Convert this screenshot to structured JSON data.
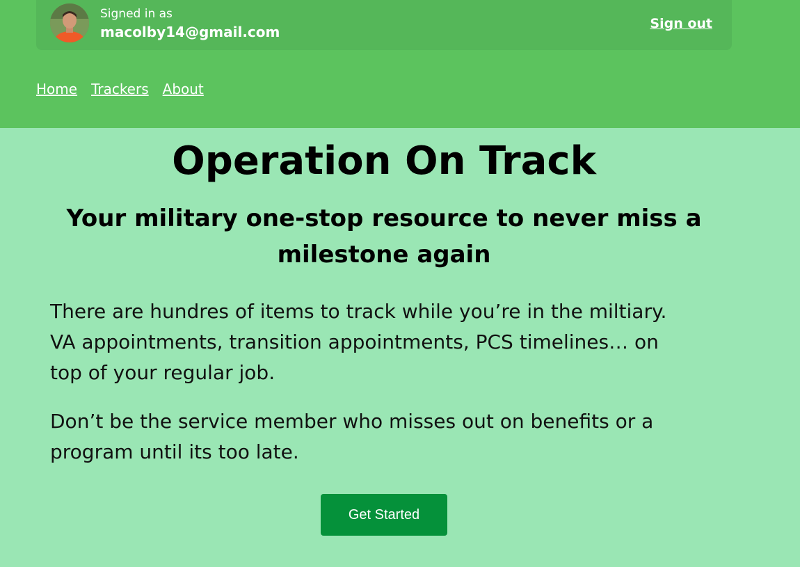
{
  "account": {
    "signed_in_label": "Signed in as",
    "email": "macolby14@gmail.com",
    "sign_out_label": "Sign out"
  },
  "nav": {
    "items": [
      {
        "label": "Home"
      },
      {
        "label": "Trackers"
      },
      {
        "label": "About"
      }
    ]
  },
  "hero": {
    "title": "Operation On Track",
    "subtitle": "Your military one-stop resource to never miss a milestone again",
    "paragraphs": [
      "There are hundres of items to track while you’re in the miltiary. VA appointments, transition appointments, PCS timelines… on top of your regular job.",
      "Don’t be the service member who misses out on benefits or a program until its too late."
    ],
    "cta_label": "Get Started"
  },
  "colors": {
    "header_bg": "#5cc35e",
    "page_bg": "#9ae6b4",
    "button_bg": "#05913a"
  }
}
